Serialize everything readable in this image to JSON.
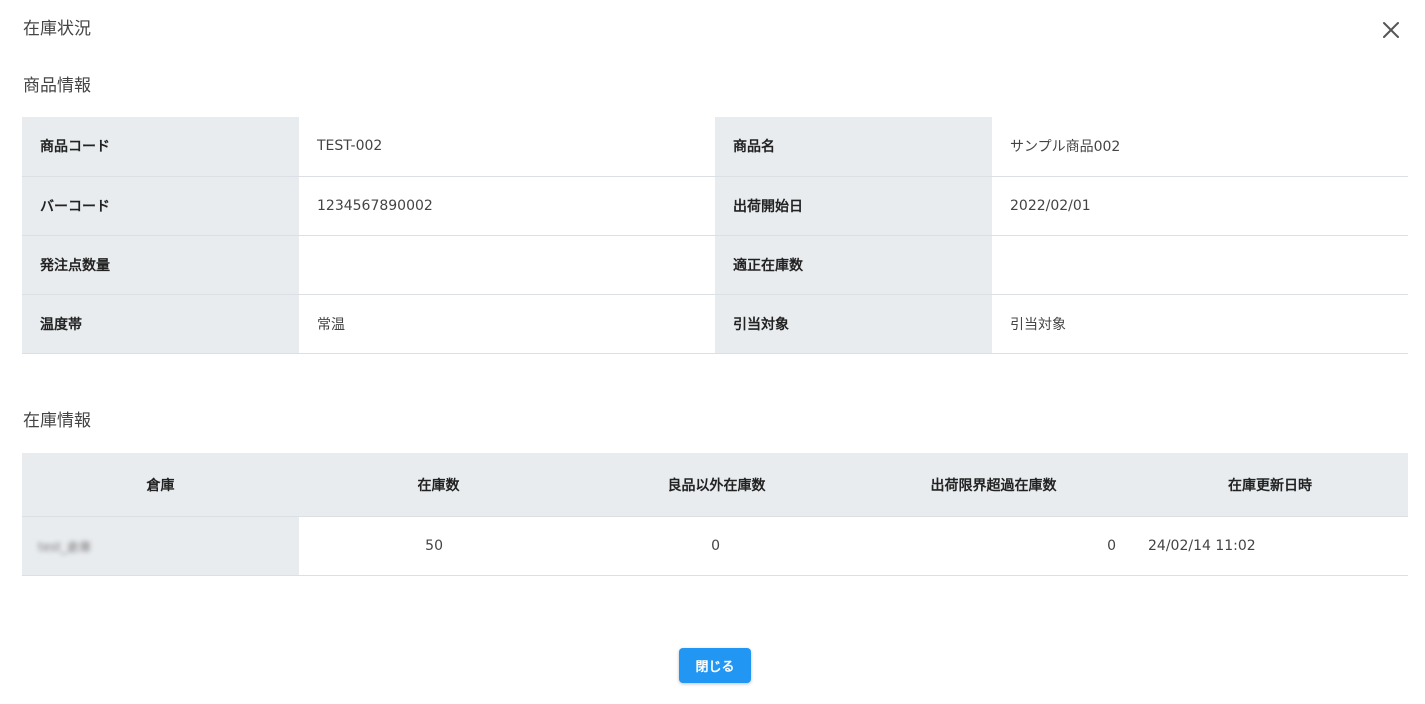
{
  "dialog": {
    "title": "在庫状況"
  },
  "product_section": {
    "title": "商品情報",
    "rows": [
      {
        "label1": "商品コード",
        "value1": "TEST-002",
        "label2": "商品名",
        "value2": "サンプル商品002"
      },
      {
        "label1": "バーコード",
        "value1": "1234567890002",
        "label2": "出荷開始日",
        "value2": "2022/02/01"
      },
      {
        "label1": "発注点数量",
        "value1": "",
        "label2": "適正在庫数",
        "value2": ""
      },
      {
        "label1": "温度帯",
        "value1": "常温",
        "label2": "引当対象",
        "value2": "引当対象"
      }
    ]
  },
  "stock_section": {
    "title": "在庫情報",
    "headers": [
      "倉庫",
      "在庫数",
      "良品以外在庫数",
      "出荷限界超過在庫数",
      "在庫更新日時"
    ],
    "rows": [
      {
        "warehouse": "test_倉庫",
        "quantity": "50",
        "non_good": "0",
        "over_limit": "0",
        "updated_at": "24/02/14 11:02"
      }
    ]
  },
  "footer": {
    "close_label": "閉じる"
  },
  "colors": {
    "header_bg": "#e9ecef",
    "primary_button": "#2196f3"
  },
  "icons": {
    "close": "close-icon"
  }
}
